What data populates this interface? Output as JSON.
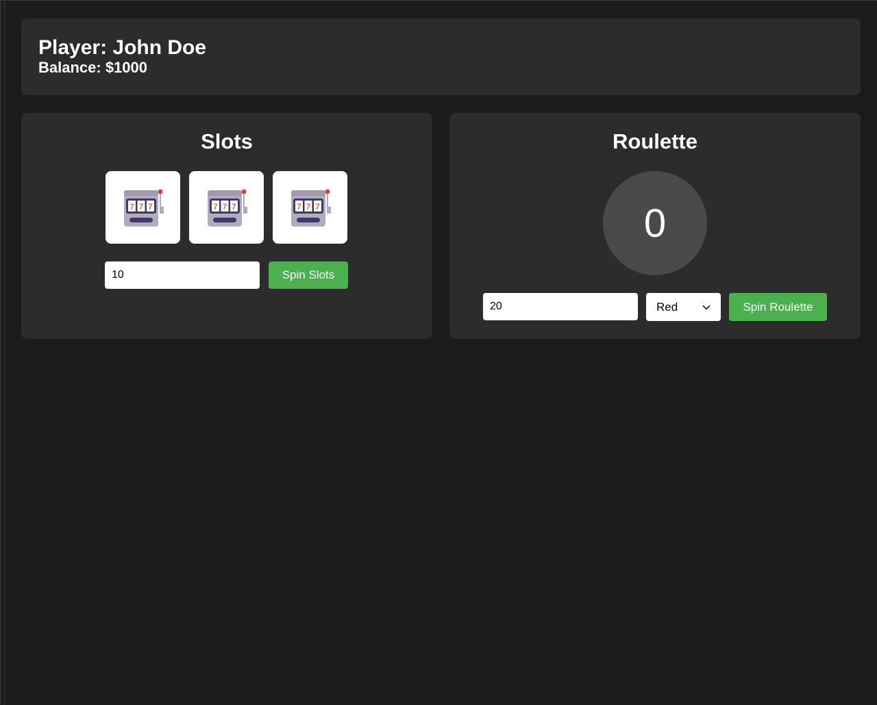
{
  "player": {
    "name_line": "Player: John Doe",
    "balance_line": "Balance: $1000"
  },
  "slots": {
    "title": "Slots",
    "reels": [
      "slot-machine-icon",
      "slot-machine-icon",
      "slot-machine-icon"
    ],
    "bet_value": "10",
    "spin_label": "Spin Slots"
  },
  "roulette": {
    "title": "Roulette",
    "result": "0",
    "bet_value": "20",
    "color_selected": "Red",
    "spin_label": "Spin Roulette"
  },
  "colors": {
    "background": "#1b1b1b",
    "card": "#2c2c2c",
    "accent": "#4caf50",
    "wheel": "#4a4a4a"
  }
}
